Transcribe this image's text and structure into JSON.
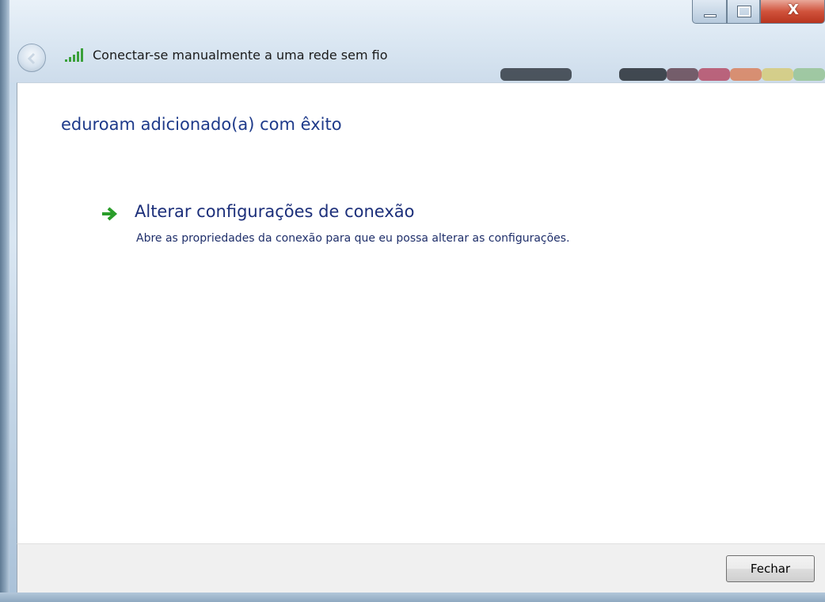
{
  "window": {
    "title": "Conectar-se manualmente a uma rede sem fio",
    "close_glyph": "X"
  },
  "main": {
    "heading": "eduroam adicionado(a) com êxito",
    "link_title": "Alterar configurações de conexão",
    "link_description": "Abre as propriedades da conexão para que eu possa alterar as configurações."
  },
  "footer": {
    "close_label": "Fechar"
  },
  "icons": {
    "back": "back-arrow-icon",
    "wifi": "wifi-signal-icon",
    "link_arrow": "green-arrow-icon"
  },
  "colors": {
    "heading": "#1e3a8a",
    "link_arrow": "#2a9d2a",
    "close_button_caption": "#c8432b"
  }
}
